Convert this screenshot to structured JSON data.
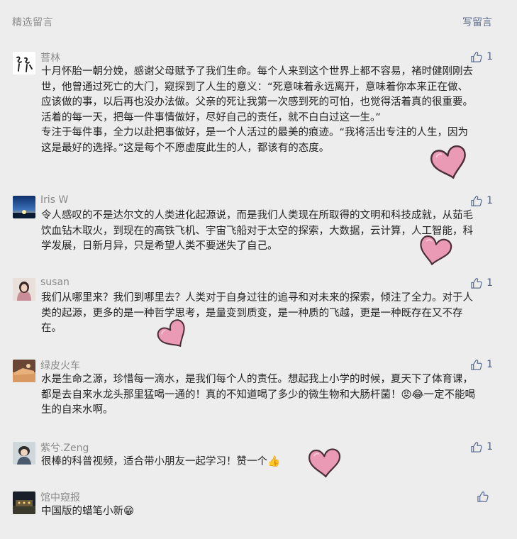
{
  "header": {
    "title": "精选留言",
    "write_label": "写留言"
  },
  "comments": [
    {
      "name": "菩林",
      "likes": "1",
      "text": [
        "十月怀胎一朝分娩，感谢父母赋予了我们生命。每个人来到这个世界上都不容易，褚时健刚刚去世，他曾通过死亡的大门，窥探到了人生的意义：“死意味着永远离开，意味着你本来正在做、应该做的事，以后再也没办法做。父亲的死让我第一次感到死的可怕，也觉得活着真的很重要。活着的每一天，把每一件事情做好，尽好自己的责任，就不白白过这一生。”",
        "专注于每件事，全力以赴把事做好，是一个人活过的最美的痕迹。“我将活出专注的人生，因为这是最好的选择。”这是每个不愿虚度此生的人，都该有的态度。"
      ]
    },
    {
      "name": "Iris W",
      "likes": "1",
      "text": [
        "令人感叹的不是达尔文的人类进化起源说，而是我们人类现在所取得的文明和科技成就，从茹毛饮血钻木取火，到现在的高铁飞机、宇宙飞船对于太空的探索，大数据，云计算，人工智能，科学发展，日新月异，只是希望人类不要迷失了自己。"
      ]
    },
    {
      "name": "susan",
      "likes": "1",
      "text": [
        "我们从哪里来？我们到哪里去？人类对于自身过往的追寻和对未来的探索，倾注了全力。对于人类的起源，更多的是一种哲学思考，是量变到质变，是一种质的飞越，更是一种既存在又不存在。"
      ]
    },
    {
      "name": "绿皮火车",
      "likes": "1",
      "text": [
        "水是生命之源，珍惜每一滴水，是我们每个人的责任。想起我上小学的时候，夏天下了体育课，都是去自来水龙头那里猛喝一通的！真的不知道喝了多少的微生物和大肠杆菌！😡😂一定不能喝生的自来水啊。"
      ]
    },
    {
      "name": "紫兮.Zeng",
      "likes": "1",
      "text": [
        "很棒的科普视频，适合带小朋友一起学习！赞一个👍"
      ]
    },
    {
      "name": "馆中窥报",
      "likes": "",
      "text": [
        "中国版的蜡笔小新😁"
      ]
    }
  ],
  "colors": {
    "background": "#ededed",
    "link": "#5b6b8a",
    "heart_fill": "#ea9ab4",
    "heart_stroke": "#4a2e38"
  }
}
